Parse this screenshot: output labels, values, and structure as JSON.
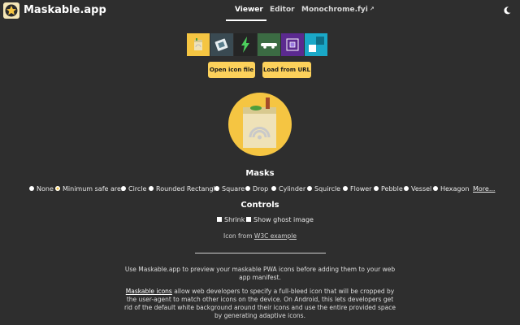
{
  "header": {
    "brand": "Maskable.app",
    "nav": [
      {
        "label": "Viewer",
        "active": true
      },
      {
        "label": "Editor",
        "active": false
      },
      {
        "label": "Monochrome.fyi",
        "active": false,
        "external": true
      }
    ]
  },
  "gallery": {
    "icons": [
      {
        "name": "shopping-bag-icon",
        "bg": "#f5c542",
        "selected": true
      },
      {
        "name": "pwa-tablet-icon",
        "bg": "#3a4a52"
      },
      {
        "name": "lightning-icon",
        "bg": "#2a2a2a"
      },
      {
        "name": "pwa-car-icon",
        "bg": "#3b6b43"
      },
      {
        "name": "chip-icon",
        "bg": "#5b2a8f"
      },
      {
        "name": "square-logo-icon",
        "bg": "#1aa8c7"
      }
    ]
  },
  "buttons": {
    "open_file": "Open icon file",
    "load_url": "Load from URL"
  },
  "masks": {
    "title": "Masks",
    "options": [
      "None",
      "Minimum safe area",
      "Circle",
      "Rounded Rectangle",
      "Square",
      "Drop",
      "Cylinder",
      "Squircle",
      "Flower",
      "Pebble",
      "Vessel",
      "Hexagon"
    ],
    "selected": "Minimum safe area",
    "more": "More..."
  },
  "controls": {
    "title": "Controls",
    "shrink": "Shrink",
    "ghost": "Show ghost image"
  },
  "credit": {
    "prefix": "Icon from",
    "link": "W3C example"
  },
  "intro": {
    "p1": "Use Maskable.app to preview your maskable PWA icons before adding them to your web app manifest.",
    "p2_link": "Maskable icons",
    "p2_rest": "allow web developers to specify a full-bleed icon that will be cropped by the user-agent to match other icons on the device. On Android, this lets developers get rid of the default white background around their icons and use the entire provided space by generating adaptive icons."
  },
  "colors": {
    "background": "#2e2e2e",
    "accent": "#fcd15b",
    "icon_yellow": "#f5c542"
  }
}
